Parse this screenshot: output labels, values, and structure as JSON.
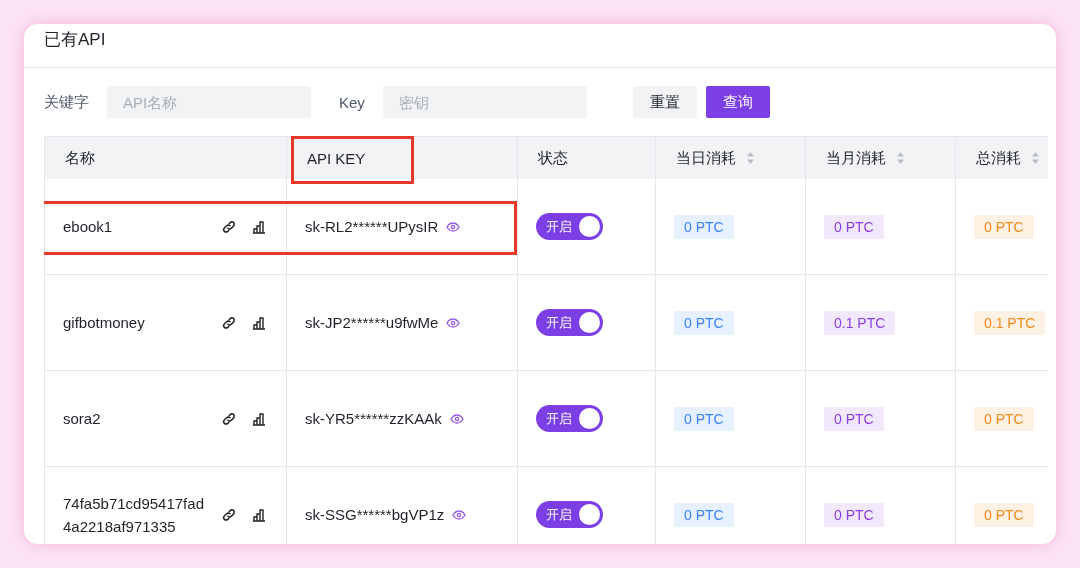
{
  "panel": {
    "title": "已有API"
  },
  "filters": {
    "keyword_label": "关键字",
    "keyword_placeholder": "API名称",
    "key_label": "Key",
    "key_placeholder": "密钥",
    "reset_button": "重置",
    "search_button": "查询"
  },
  "table": {
    "columns": [
      {
        "label": "名称",
        "sortable": false,
        "highlighted": false
      },
      {
        "label": "API KEY",
        "sortable": false,
        "highlighted": true
      },
      {
        "label": "状态",
        "sortable": false,
        "highlighted": false
      },
      {
        "label": "当日消耗",
        "sortable": true,
        "highlighted": false,
        "color": "#3b82f6"
      },
      {
        "label": "当月消耗",
        "sortable": true,
        "highlighted": false,
        "color": "#8b3fe0"
      },
      {
        "label": "总消耗",
        "sortable": true,
        "highlighted": false,
        "color": "#f28a1e"
      }
    ],
    "rows": [
      {
        "name": "ebook1",
        "key": "sk-RL2******UPysIR",
        "status": {
          "label": "开启",
          "on": true
        },
        "daily": "0 PTC",
        "monthly": "0 PTC",
        "total": "0 PTC",
        "highlighted": true
      },
      {
        "name": "gifbotmoney",
        "key": "sk-JP2******u9fwMe",
        "status": {
          "label": "开启",
          "on": true
        },
        "daily": "0 PTC",
        "monthly": "0.1 PTC",
        "total": "0.1 PTC",
        "highlighted": false
      },
      {
        "name": "sora2",
        "key": "sk-YR5******zzKAAk",
        "status": {
          "label": "开启",
          "on": true
        },
        "daily": "0 PTC",
        "monthly": "0 PTC",
        "total": "0 PTC",
        "highlighted": false
      },
      {
        "name": "74fa5b71cd95417fad4a2218af971335",
        "key": "sk-SSG******bgVP1z",
        "status": {
          "label": "开启",
          "on": true
        },
        "daily": "0 PTC",
        "monthly": "0 PTC",
        "total": "0 PTC",
        "highlighted": false
      }
    ]
  }
}
